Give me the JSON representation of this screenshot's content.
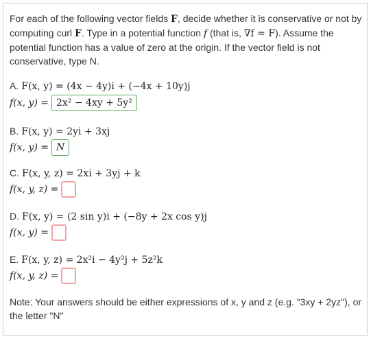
{
  "intro": {
    "text_a": "For each of the following vector fields ",
    "F": "F",
    "text_b": ", decide whether it is conservative or not by computing curl ",
    "text_c": ". Type in a potential function ",
    "f": "f",
    "text_d": " (that is, ",
    "nabla_f": "∇f = F",
    "text_e": "). Assume the potential function has a value of zero at the origin. If the vector field is not conservative, type N."
  },
  "parts": [
    {
      "label": "A.",
      "field": "F(x, y) = (4x − 4y)i + (−4x + 10y)j",
      "f_label": "f(x, y) =",
      "answer": "2x² − 4xy + 5y²",
      "status": "correct"
    },
    {
      "label": "B.",
      "field": "F(x, y) = 2yi + 3xj",
      "f_label": "f(x, y) =",
      "answer": "N",
      "status": "correct"
    },
    {
      "label": "C.",
      "field": "F(x, y, z) = 2xi + 3yj + k",
      "f_label": "f(x, y, z) =",
      "answer": "",
      "status": "empty"
    },
    {
      "label": "D.",
      "field": "F(x, y) = (2 sin y)i + (−8y + 2x cos y)j",
      "f_label": "f(x, y) =",
      "answer": "",
      "status": "empty"
    },
    {
      "label": "E.",
      "field": "F(x, y, z) = 2x²i − 4y²j + 5z²k",
      "f_label": "f(x, y, z) =",
      "answer": "",
      "status": "empty"
    }
  ],
  "note": "Note: Your answers should be either expressions of x, y and z (e.g. \"3xy + 2yz\"), or the letter \"N\"",
  "colors": {
    "correct_border": "#5da75d",
    "empty_border": "#f4a3a3",
    "text": "#333333"
  }
}
